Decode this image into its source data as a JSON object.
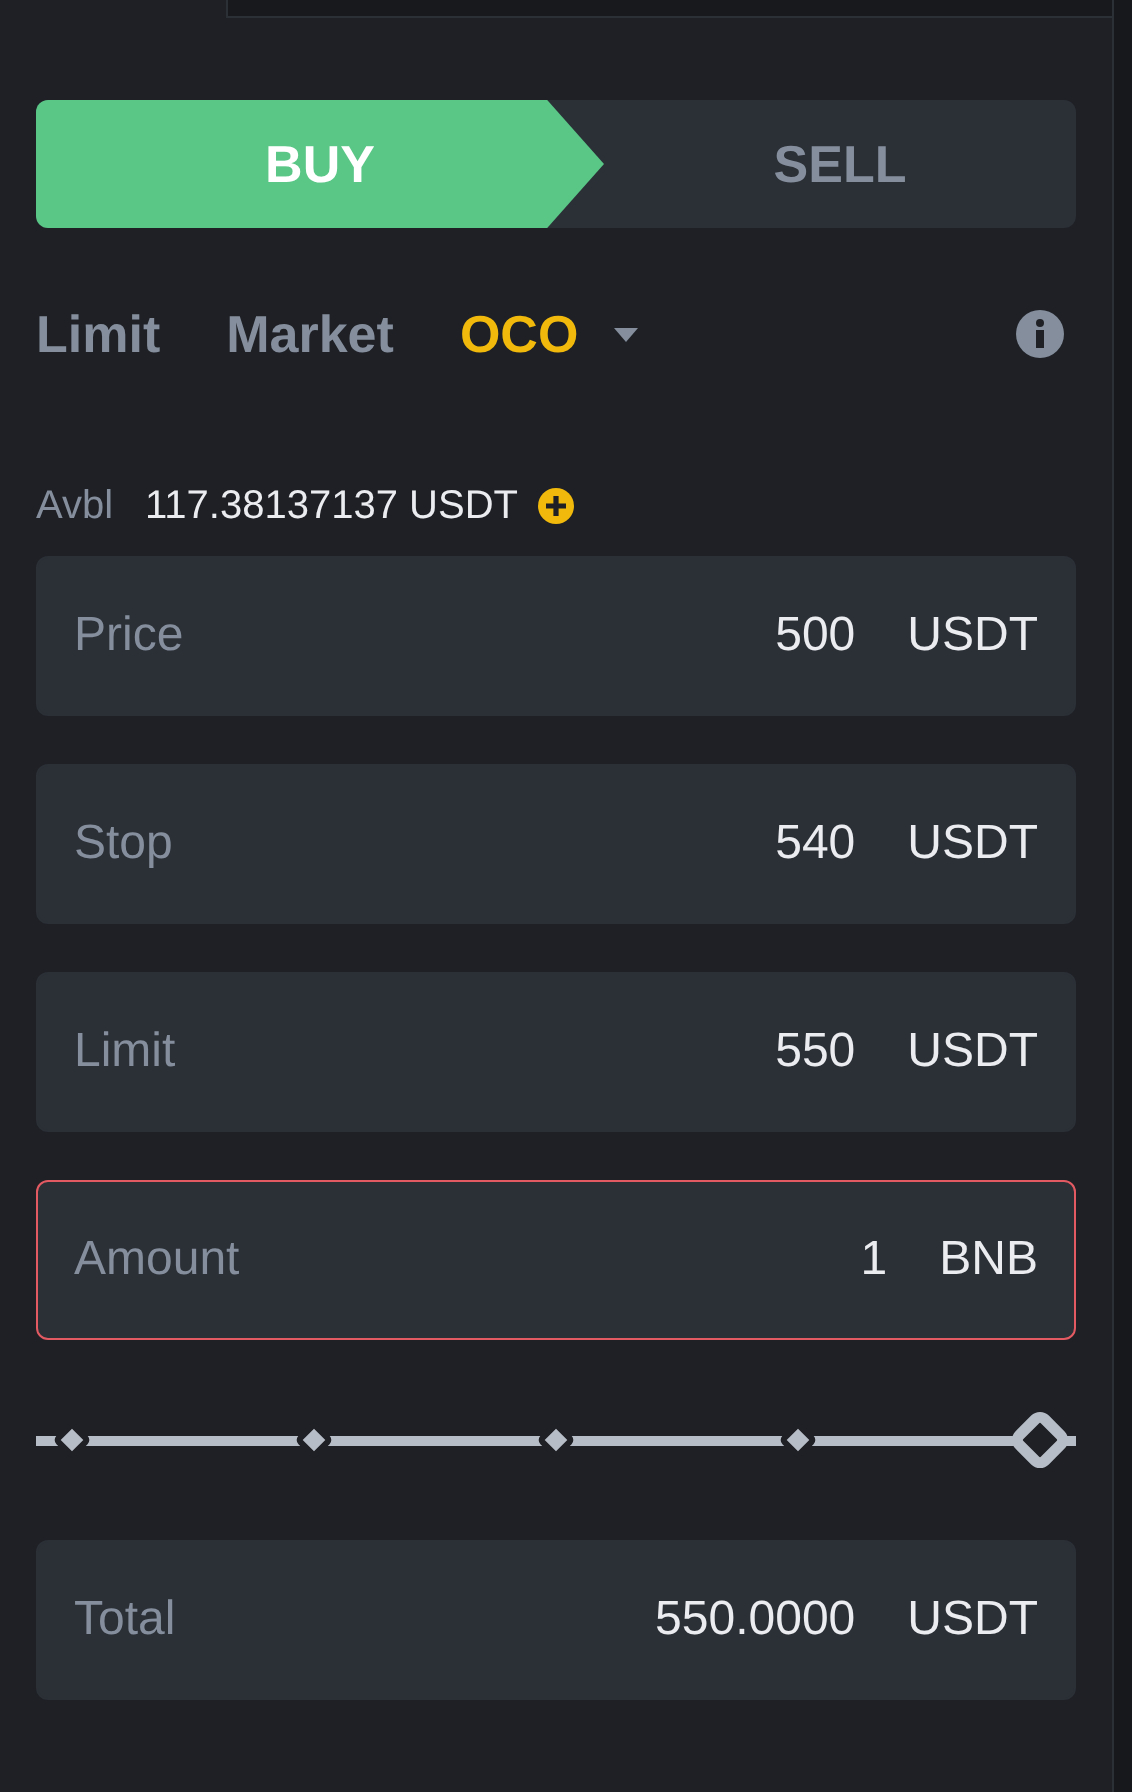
{
  "sides": [
    {
      "label": "BUY",
      "kind": "buy",
      "selected": true
    },
    {
      "label": "SELL",
      "kind": "sell",
      "selected": false
    }
  ],
  "order_types": [
    {
      "label": "Limit",
      "selected": false,
      "dropdown": false
    },
    {
      "label": "Market",
      "selected": false,
      "dropdown": false
    },
    {
      "label": "OCO",
      "selected": true,
      "dropdown": true
    }
  ],
  "available": {
    "label": "Avbl",
    "value": "117.38137137 USDT"
  },
  "fields": [
    {
      "label": "Price",
      "value": "500",
      "unit": "USDT",
      "error": false
    },
    {
      "label": "Stop",
      "value": "540",
      "unit": "USDT",
      "error": false
    },
    {
      "label": "Limit",
      "value": "550",
      "unit": "USDT",
      "error": false
    },
    {
      "label": "Amount",
      "value": "1",
      "unit": "BNB",
      "error": true
    }
  ],
  "slider": {
    "level": 1
  },
  "total": {
    "label": "Total",
    "value": "550.0000",
    "unit": "USDT"
  }
}
